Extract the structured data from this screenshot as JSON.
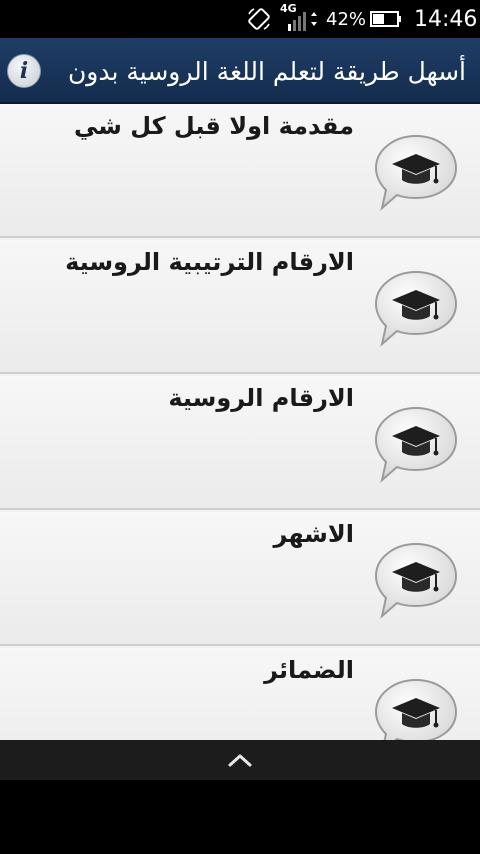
{
  "status_bar": {
    "network": "4G",
    "battery_percent": "42%",
    "time": "14:46",
    "icons": [
      "screen-rotation-icon",
      "signal-icon",
      "battery-icon"
    ]
  },
  "header": {
    "title": "أسهل طريقة لتعلم اللغة الروسية بدون",
    "info_icon": "info-icon",
    "info_glyph": "i"
  },
  "list": {
    "items": [
      {
        "label": "مقدمة اولا قبل كل شي",
        "icon": "graduation-cap-bubble-icon"
      },
      {
        "label": "الارقام الترتيبية الروسية",
        "icon": "graduation-cap-bubble-icon"
      },
      {
        "label": "الارقام الروسية",
        "icon": "graduation-cap-bubble-icon"
      },
      {
        "label": "الاشهر",
        "icon": "graduation-cap-bubble-icon"
      },
      {
        "label": "الضمائر",
        "icon": "graduation-cap-bubble-icon"
      }
    ]
  },
  "bottom_bar": {
    "icon": "chevron-up-icon"
  },
  "colors": {
    "header_bg": "#1a365d",
    "list_bg": "#f0f0f0",
    "bottom_bar_bg": "#1c1c1c"
  }
}
